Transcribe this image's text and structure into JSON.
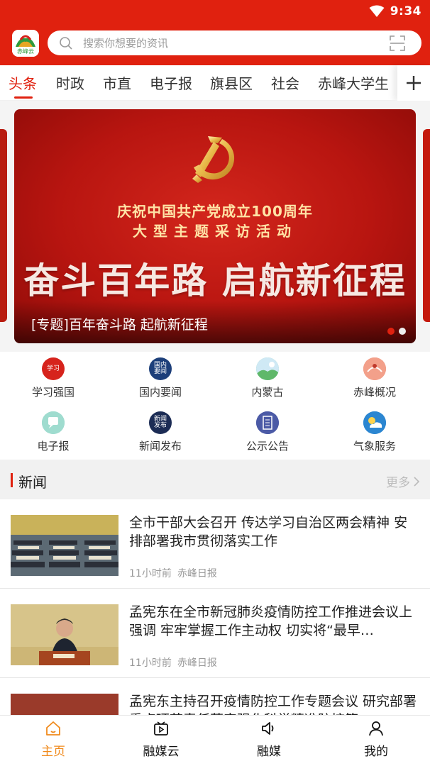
{
  "status": {
    "time": "9:34"
  },
  "header": {
    "search_placeholder": "搜索你想要的资讯",
    "logo_text": "赤峰云"
  },
  "tabs": [
    {
      "label": "头条",
      "active": true
    },
    {
      "label": "时政"
    },
    {
      "label": "市直"
    },
    {
      "label": "电子报"
    },
    {
      "label": "旗县区"
    },
    {
      "label": "社会"
    },
    {
      "label": "赤峰大学生"
    }
  ],
  "banner": {
    "line1": "庆祝中国共产党成立100周年",
    "line2": "大型主题采访活动",
    "headline": "奋斗百年路 启航新征程",
    "caption": "[专题]百年奋斗路  起航新征程",
    "slides": 2,
    "current_slide": 1
  },
  "quick_links": [
    {
      "label": "学习强国",
      "icon": "xuexi-icon",
      "icon_text": "学习",
      "color": "#d6231c"
    },
    {
      "label": "国内要闻",
      "icon": "domestic-news-icon",
      "icon_text": "国内要闻",
      "color": "#1d3f7a"
    },
    {
      "label": "内蒙古",
      "icon": "inner-mongolia-icon",
      "icon_text": "",
      "color": "#7cc3a6"
    },
    {
      "label": "赤峰概况",
      "icon": "chifeng-overview-icon",
      "icon_text": "",
      "color": "#e9826e"
    },
    {
      "label": "电子报",
      "icon": "e-paper-icon",
      "icon_text": "",
      "color": "#8fd4c9"
    },
    {
      "label": "新闻发布",
      "icon": "press-release-icon",
      "icon_text": "新闻发布",
      "color": "#1c2c55"
    },
    {
      "label": "公示公告",
      "icon": "announcement-icon",
      "icon_text": "",
      "color": "#4b5aa6"
    },
    {
      "label": "气象服务",
      "icon": "weather-icon",
      "icon_text": "",
      "color": "#2b86d1"
    }
  ],
  "section": {
    "title": "新闻",
    "more": "更多"
  },
  "news": [
    {
      "title": "全市干部大会召开  传达学习自治区两会精神  安排部署我市贯彻落实工作",
      "time": "11小时前",
      "source": "赤峰日报"
    },
    {
      "title": "孟宪东在全市新冠肺炎疫情防控工作推进会议上强调  牢牢掌握工作主动权  切实将“最早…",
      "time": "11小时前",
      "source": "赤峰日报"
    },
    {
      "title": "孟宪东主持召开疫情防控工作专题会议  研究部署重点环节责任落实强化科学精准防控策",
      "time": "",
      "source": ""
    }
  ],
  "bottom_nav": [
    {
      "label": "主页",
      "active": true
    },
    {
      "label": "融媒云"
    },
    {
      "label": "融媒"
    },
    {
      "label": "我的"
    }
  ],
  "colors": {
    "brand_red": "#e0210f",
    "nav_active": "#f08a1c"
  }
}
